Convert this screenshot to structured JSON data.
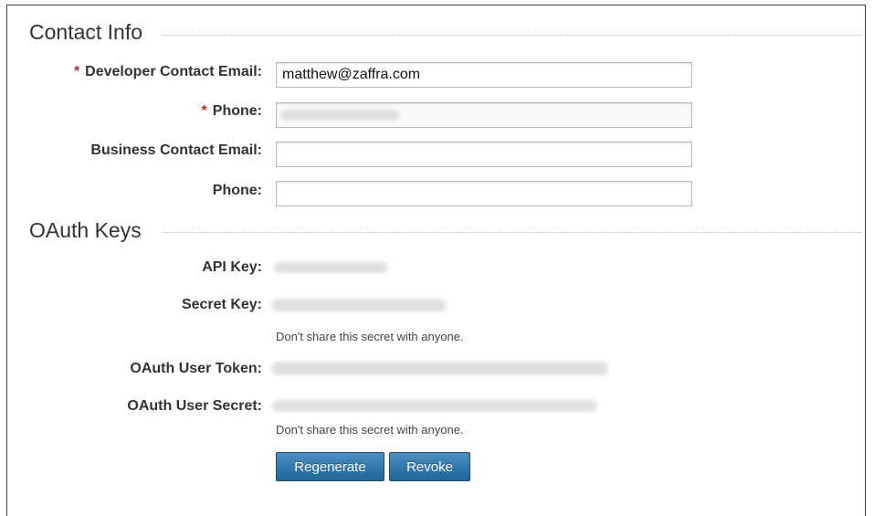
{
  "contact_info": {
    "title": "Contact Info",
    "developer_email": {
      "label": "Developer Contact Email:",
      "value": "matthew@zaffra.com"
    },
    "phone": {
      "label": "Phone:"
    },
    "business_email": {
      "label": "Business Contact Email:",
      "value": ""
    },
    "business_phone": {
      "label": "Phone:",
      "value": ""
    },
    "required_marker": "*"
  },
  "oauth_keys": {
    "title": "OAuth Keys",
    "api_key": {
      "label": "API Key:"
    },
    "secret_key": {
      "label": "Secret Key:"
    },
    "secret_note": "Don't share this secret with anyone.",
    "user_token": {
      "label": "OAuth User Token:"
    },
    "user_secret": {
      "label": "OAuth User Secret:"
    },
    "user_secret_note": "Don't share this secret with anyone."
  },
  "buttons": {
    "regenerate": "Regenerate",
    "revoke": "Revoke"
  },
  "colors": {
    "required": "#c0272d",
    "button": "#2a73a8"
  }
}
